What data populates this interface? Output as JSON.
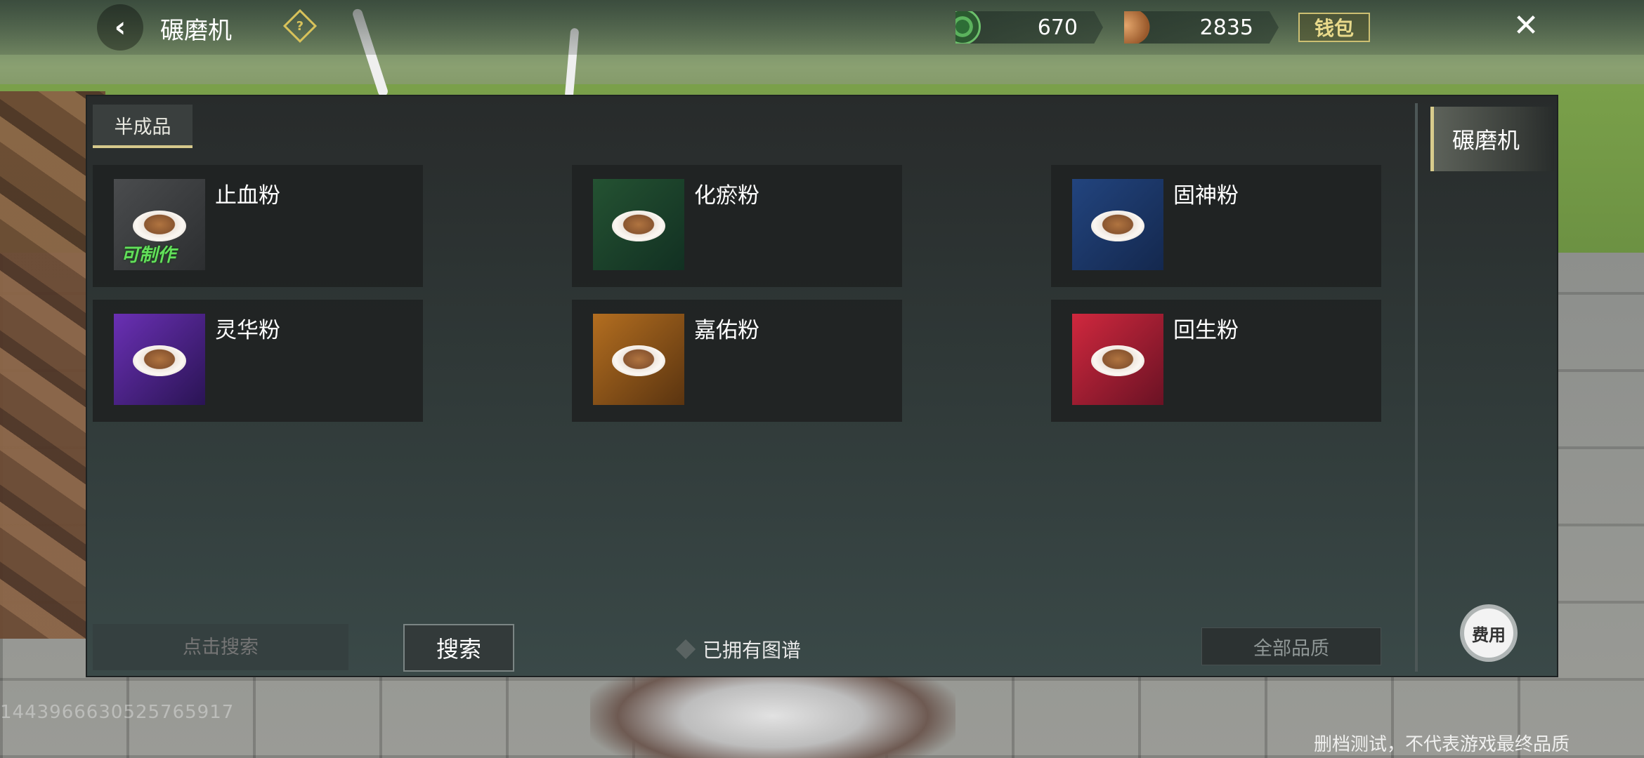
{
  "header": {
    "title": "碾磨机",
    "currency1_value": "670",
    "currency2_value": "2835",
    "wallet_label": "钱包"
  },
  "panel": {
    "tab_label": "半成品",
    "items": [
      {
        "name": "止血粉",
        "tag": "可制作",
        "color": "#3a3c3e"
      },
      {
        "name": "化瘀粉",
        "tag": "",
        "color": "#1d4a2c"
      },
      {
        "name": "固神粉",
        "tag": "",
        "color": "#1e3d72"
      },
      {
        "name": "灵华粉",
        "tag": "",
        "color": "#5a2aa0"
      },
      {
        "name": "嘉佑粉",
        "tag": "",
        "color": "#9a5e1a"
      },
      {
        "name": "回生粉",
        "tag": "",
        "color": "#b8223a"
      }
    ],
    "search_placeholder": "点击搜索",
    "search_button": "搜索",
    "owned_recipes_label": "已拥有图谱",
    "quality_filter": "全部品质"
  },
  "side": {
    "tab_label": "碾磨机",
    "fee_label": "费用"
  },
  "footer": {
    "watermark_id": "1443966630525765917",
    "disclaimer": "删档测试，不代表游戏最终品质"
  }
}
